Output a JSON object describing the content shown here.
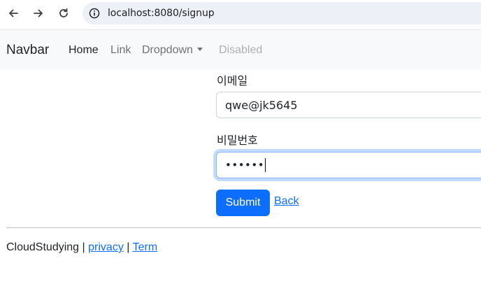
{
  "browser": {
    "url": "localhost:8080/signup"
  },
  "navbar": {
    "brand": "Navbar",
    "links": [
      {
        "label": "Home"
      },
      {
        "label": "Link"
      },
      {
        "label": "Dropdown"
      },
      {
        "label": "Disabled"
      }
    ]
  },
  "form": {
    "email_label": "이메일",
    "email_value": "qwe@jk5645",
    "password_label": "비밀번호",
    "password_masked": "••••••",
    "submit_label": "Submit",
    "back_label": "Back"
  },
  "footer": {
    "brand": "CloudStudying",
    "separator": "|",
    "privacy": "privacy",
    "term": "Term"
  }
}
